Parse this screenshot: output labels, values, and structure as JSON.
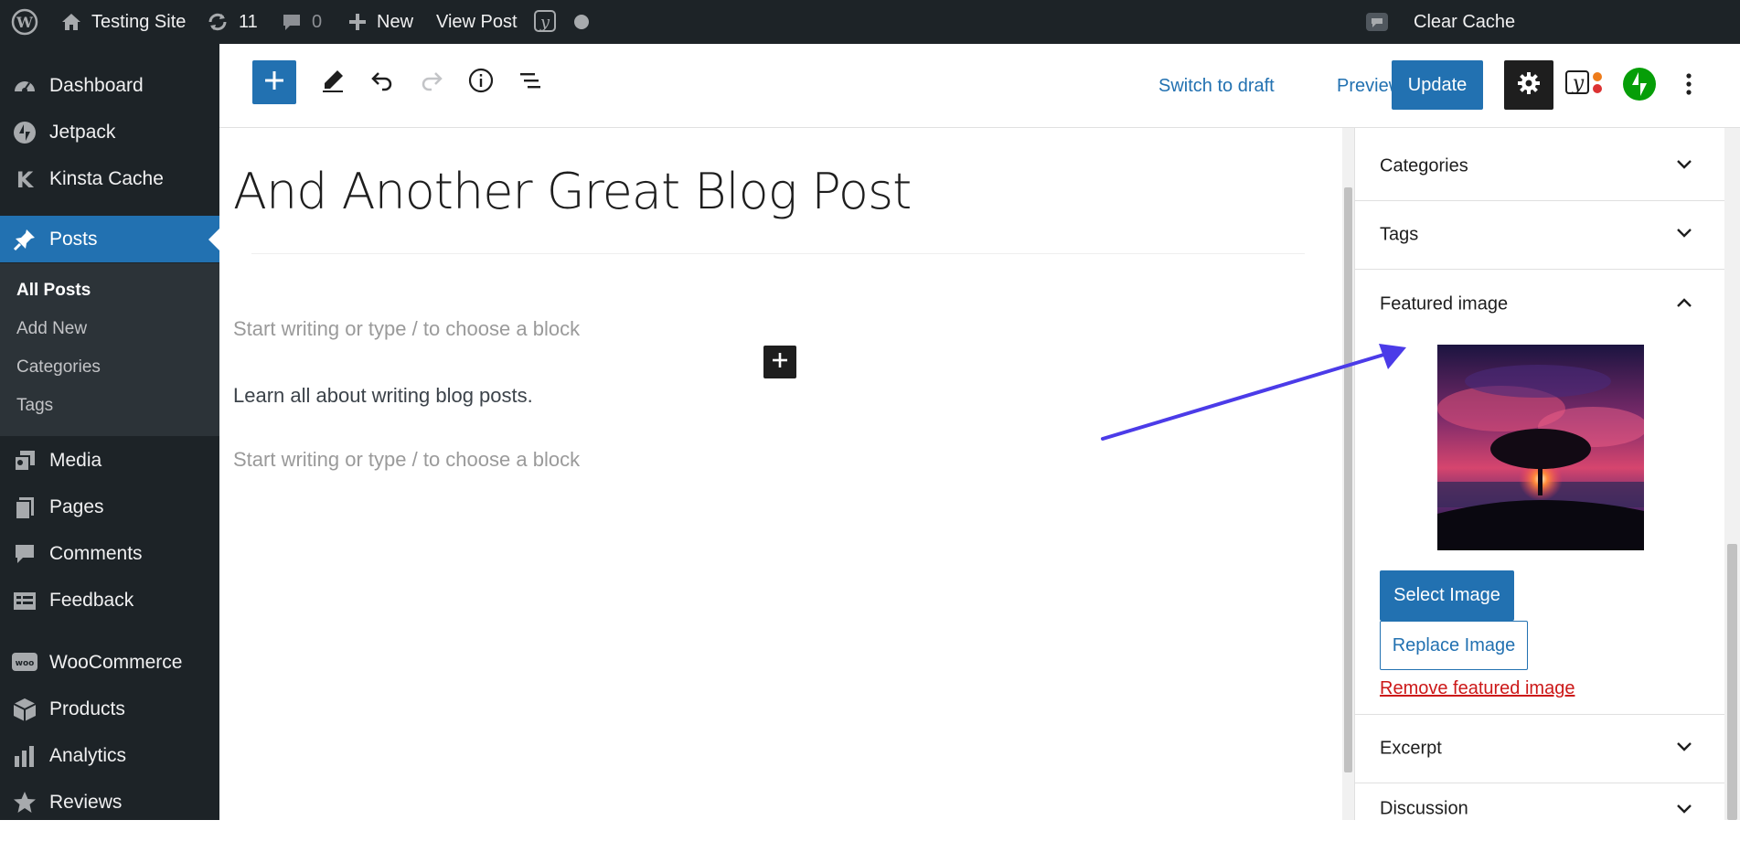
{
  "adminbar": {
    "site_name": "Testing Site",
    "updates_count": "11",
    "comments_count": "0",
    "new_label": "New",
    "view_post_label": "View Post",
    "clear_cache_label": "Clear Cache"
  },
  "sidebar": {
    "items": [
      {
        "label": "Dashboard",
        "icon": "dashboard-icon"
      },
      {
        "label": "Jetpack",
        "icon": "jetpack-icon"
      },
      {
        "label": "Kinsta Cache",
        "icon": "kinsta-icon"
      },
      {
        "label": "Posts",
        "icon": "pushpin-icon",
        "active": true
      },
      {
        "label": "Media",
        "icon": "media-icon"
      },
      {
        "label": "Pages",
        "icon": "pages-icon"
      },
      {
        "label": "Comments",
        "icon": "comment-bubble-icon"
      },
      {
        "label": "Feedback",
        "icon": "feedback-icon"
      },
      {
        "label": "WooCommerce",
        "icon": "woo-icon"
      },
      {
        "label": "Products",
        "icon": "box-icon"
      },
      {
        "label": "Analytics",
        "icon": "bar-chart-icon"
      },
      {
        "label": "Reviews",
        "icon": "star-icon"
      }
    ],
    "submenu": [
      "All Posts",
      "Add New",
      "Categories",
      "Tags"
    ]
  },
  "toolbar": {
    "switch_to_draft": "Switch to draft",
    "preview": "Preview",
    "update": "Update"
  },
  "editor": {
    "title": "And Another Great Blog Post",
    "placeholder_1": "Start writing or type / to choose a block",
    "paragraph": "Learn all about writing blog posts.",
    "placeholder_2": "Start writing or type / to choose a block"
  },
  "settings": {
    "categories": "Categories",
    "tags": "Tags",
    "featured_image": "Featured image",
    "select_image": "Select Image",
    "replace_image": "Replace Image",
    "remove_featured_image": "Remove featured image",
    "excerpt": "Excerpt",
    "discussion": "Discussion"
  },
  "colors": {
    "admin_dark": "#1d2327",
    "wp_blue": "#2271b1",
    "annotation_arrow": "#4b3be8",
    "danger": "#cc1818"
  }
}
